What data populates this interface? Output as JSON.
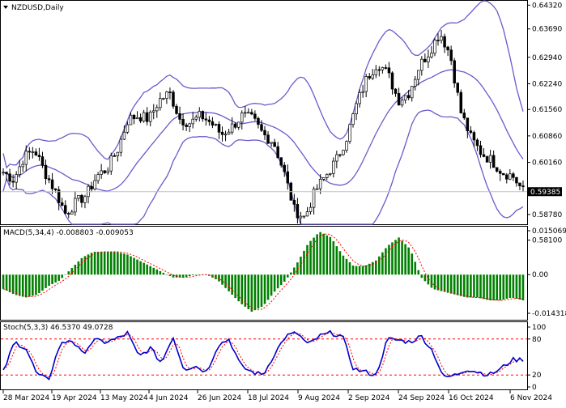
{
  "window": {
    "title": "NZDUSD,Daily",
    "title_icon": "triangle-down-icon"
  },
  "colors": {
    "background": "#ffffff",
    "border": "#000000",
    "candle_up": "#000000",
    "candle_down": "#000000",
    "bollinger": "#6a5acd",
    "macd_hist": "#008000",
    "macd_signal": "#ff0000",
    "stoch_main": "#0000cd",
    "stoch_signal": "#ff0000",
    "level_line": "#c0c0c0",
    "price_tag_bg": "#000000",
    "price_tag_text": "#ffffff"
  },
  "main_chart": {
    "price_axis": [
      "0.64320",
      "0.63690",
      "0.62940",
      "0.62240",
      "0.61560",
      "0.60860",
      "0.60160",
      "0.59385",
      "0.58780",
      "0.58100"
    ],
    "current_price": "0.59385",
    "current_price_value": 0.59385,
    "ymin": 0.5803,
    "ymax": 0.6437
  },
  "macd": {
    "label": "MACD(5,34,4) -0.008803 -0.009053",
    "axis": [
      "0.015069",
      "0.00",
      "-0.014318"
    ],
    "ymin": -0.0155,
    "ymax": 0.0162
  },
  "stoch": {
    "label": "Stoch(5,3,3) 46.5370 49.0728",
    "axis": [
      "100",
      "80",
      "20",
      "0"
    ],
    "levels": [
      80,
      20
    ]
  },
  "time_axis": [
    "28 Mar 2024",
    "19 Apr 2024",
    "13 May 2024",
    "4 Jun 2024",
    "26 Jun 2024",
    "18 Jul 2024",
    "9 Aug 2024",
    "2 Sep 2024",
    "24 Sep 2024",
    "16 Oct 2024",
    "6 Nov 2024"
  ],
  "chart_data": {
    "type": "candlestick",
    "title": "NZDUSD,Daily",
    "x_labels": [
      "28 Mar 2024",
      "19 Apr 2024",
      "13 May 2024",
      "4 Jun 2024",
      "26 Jun 2024",
      "18 Jul 2024",
      "9 Aug 2024",
      "2 Sep 2024",
      "24 Sep 2024",
      "16 Oct 2024",
      "6 Nov 2024"
    ],
    "close_trajectory": [
      0.599,
      0.597,
      0.603,
      0.605,
      0.599,
      0.594,
      0.588,
      0.591,
      0.593,
      0.598,
      0.6,
      0.605,
      0.613,
      0.614,
      0.613,
      0.618,
      0.62,
      0.613,
      0.612,
      0.614,
      0.612,
      0.609,
      0.611,
      0.614,
      0.613,
      0.609,
      0.607,
      0.599,
      0.589,
      0.587,
      0.594,
      0.598,
      0.602,
      0.608,
      0.617,
      0.624,
      0.628,
      0.625,
      0.618,
      0.62,
      0.627,
      0.631,
      0.636,
      0.63,
      0.615,
      0.608,
      0.604,
      0.602,
      0.599,
      0.598,
      0.594
    ],
    "macd_hist_trajectory": [
      -0.005,
      -0.007,
      -0.008,
      -0.007,
      -0.004,
      -0.002,
      0.002,
      0.006,
      0.008,
      0.008,
      0.008,
      0.007,
      0.005,
      0.003,
      0.001,
      -0.001,
      -0.001,
      0.0,
      0.0,
      -0.002,
      -0.006,
      -0.01,
      -0.013,
      -0.011,
      -0.006,
      -0.002,
      0.004,
      0.011,
      0.015,
      0.013,
      0.007,
      0.003,
      0.003,
      0.005,
      0.01,
      0.013,
      0.009,
      -0.001,
      -0.005,
      -0.006,
      -0.007,
      -0.008,
      -0.008,
      -0.009,
      -0.009,
      -0.008,
      -0.009
    ],
    "stoch_trajectory": [
      25,
      75,
      65,
      20,
      12,
      70,
      80,
      55,
      78,
      75,
      80,
      90,
      50,
      65,
      40,
      85,
      30,
      35,
      25,
      70,
      80,
      35,
      25,
      20,
      55,
      85,
      90,
      70,
      85,
      90,
      85,
      30,
      25,
      20,
      80,
      78,
      75,
      85,
      60,
      15,
      20,
      30,
      25,
      20,
      30,
      45,
      46
    ],
    "ylim": [
      0.5803,
      0.6437
    ]
  }
}
